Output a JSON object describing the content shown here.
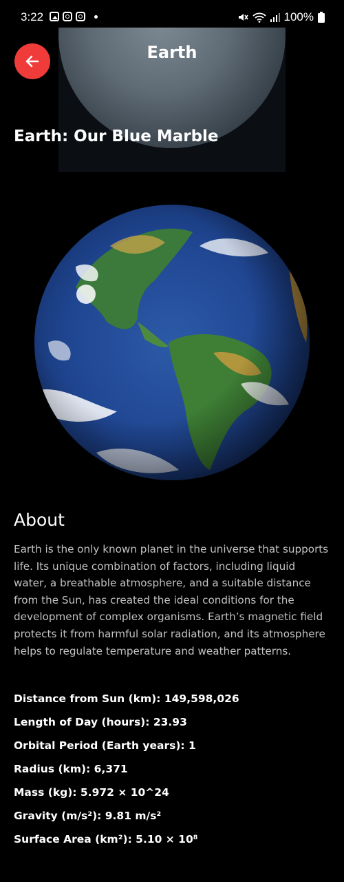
{
  "status_bar": {
    "time": "3:22",
    "left_icons": [
      "gallery-icon",
      "instagram-icon",
      "instagram-icon",
      "dot"
    ],
    "battery": "100%",
    "right_icons": [
      "mute-icon",
      "wifi-icon",
      "signal-icon",
      "battery-icon"
    ]
  },
  "header": {
    "title": "Earth",
    "back_icon": "arrow-left-icon",
    "hero_heading": "Earth: Our Blue Marble"
  },
  "about": {
    "heading": "About",
    "text": "Earth is the only known planet in the universe that supports life. Its unique combination of factors, including liquid water, a breathable atmosphere, and a suitable distance from the Sun, has created the ideal conditions for the development of complex organisms. Earth’s magnetic field protects it from harmful solar radiation, and its atmosphere helps to regulate temperature and weather patterns."
  },
  "stats": [
    "Distance from Sun (km): 149,598,026",
    "Length of Day (hours): 23.93",
    "Orbital Period (Earth years): 1",
    "Radius (km): 6,371",
    "Mass (kg): 5.972 × 10^24",
    "Gravity (m/s²): 9.81 m/s²",
    "Surface Area (km²): 5.10 × 10⁸"
  ],
  "colors": {
    "background": "#000000",
    "accent": "#ef3b39",
    "body_text": "#c2c2c2"
  }
}
